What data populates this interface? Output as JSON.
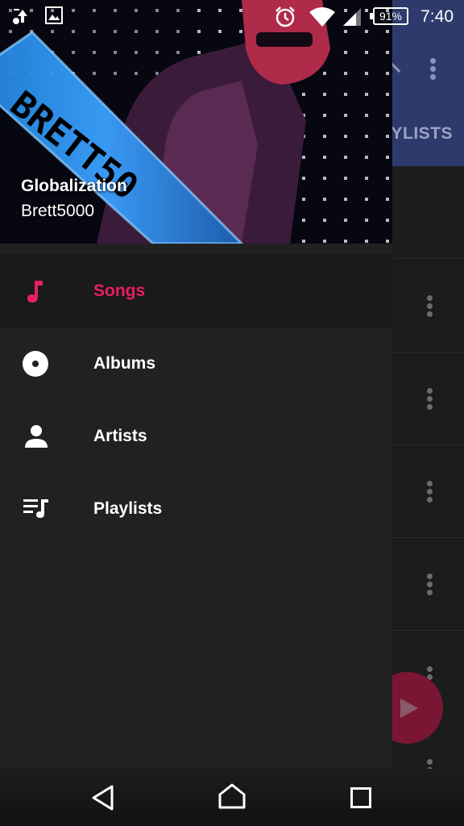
{
  "status_bar": {
    "time": "7:40",
    "battery": "91%",
    "icons": [
      "cast-icon",
      "image-icon",
      "alarm-icon",
      "wifi-icon",
      "signal-icon"
    ]
  },
  "background_app": {
    "tab_label": "YLISTS"
  },
  "drawer": {
    "now_playing": {
      "title": "Globalization",
      "artist": "Brett5000"
    },
    "items": [
      {
        "label": "Songs",
        "icon": "music-note-icon",
        "active": true
      },
      {
        "label": "Albums",
        "icon": "album-icon",
        "active": false
      },
      {
        "label": "Artists",
        "icon": "person-icon",
        "active": false
      },
      {
        "label": "Playlists",
        "icon": "playlist-icon",
        "active": false
      }
    ]
  },
  "colors": {
    "accent": "#e91e63",
    "drawer_bg": "#212121",
    "toolbar_bg": "#2d3a6b"
  },
  "nav_bar": {
    "icons": [
      "back-icon",
      "home-icon",
      "recents-icon"
    ]
  }
}
